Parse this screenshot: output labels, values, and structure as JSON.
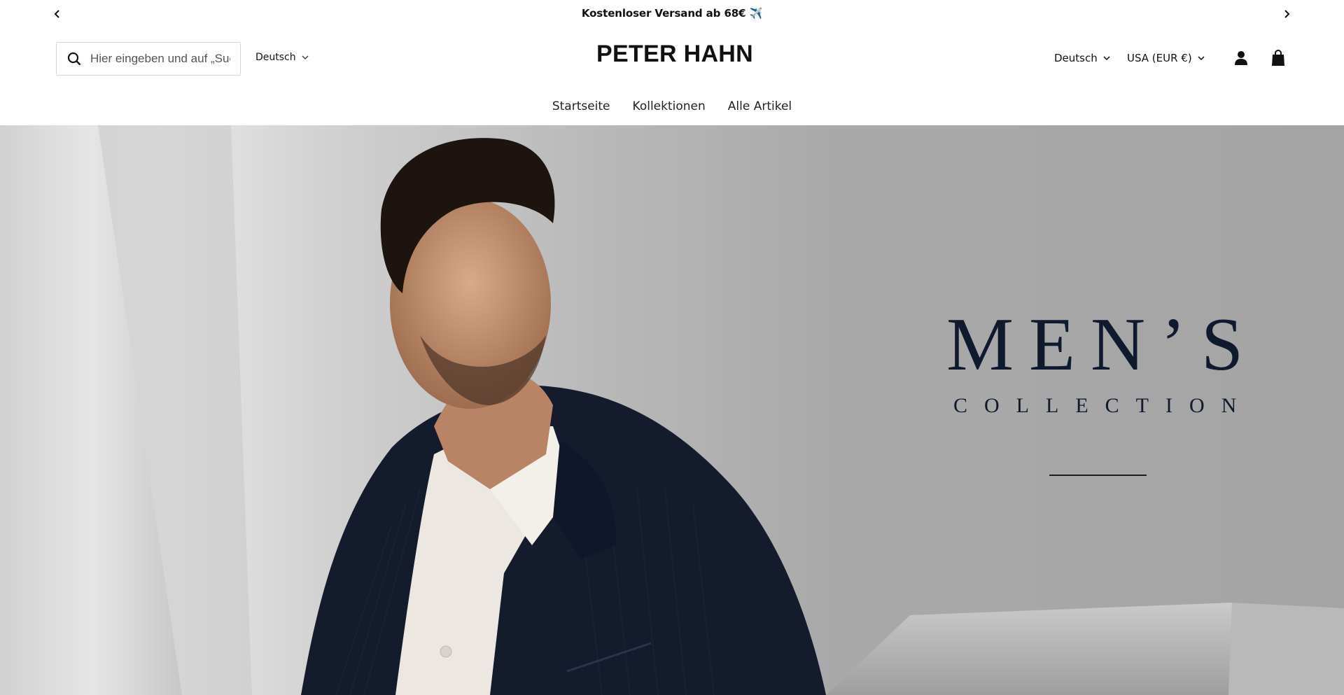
{
  "announcement": {
    "text": "Kostenloser Versand ab 68€ ✈️",
    "prev_icon": "chevron-left-icon",
    "next_icon": "chevron-right-icon"
  },
  "header": {
    "search": {
      "placeholder": "Hier eingeben und auf „Suchen“ drücken",
      "icon": "search-icon"
    },
    "language_left": "Deutsch",
    "logo": "PETER HAHN",
    "language_right": "Deutsch",
    "currency": "USA (EUR €)",
    "account_icon": "user-icon",
    "cart_icon": "shopping-bag-icon"
  },
  "nav": {
    "items": [
      {
        "label": "Startseite"
      },
      {
        "label": "Kollektionen"
      },
      {
        "label": "Alle Artikel"
      }
    ]
  },
  "hero": {
    "title": "MEN’S",
    "subtitle": "COLLECTION",
    "colors": {
      "text": "#0f1a2e",
      "jacket": "#151c2e",
      "shirt": "#ece8e1",
      "background": "#b4b4b4"
    }
  }
}
